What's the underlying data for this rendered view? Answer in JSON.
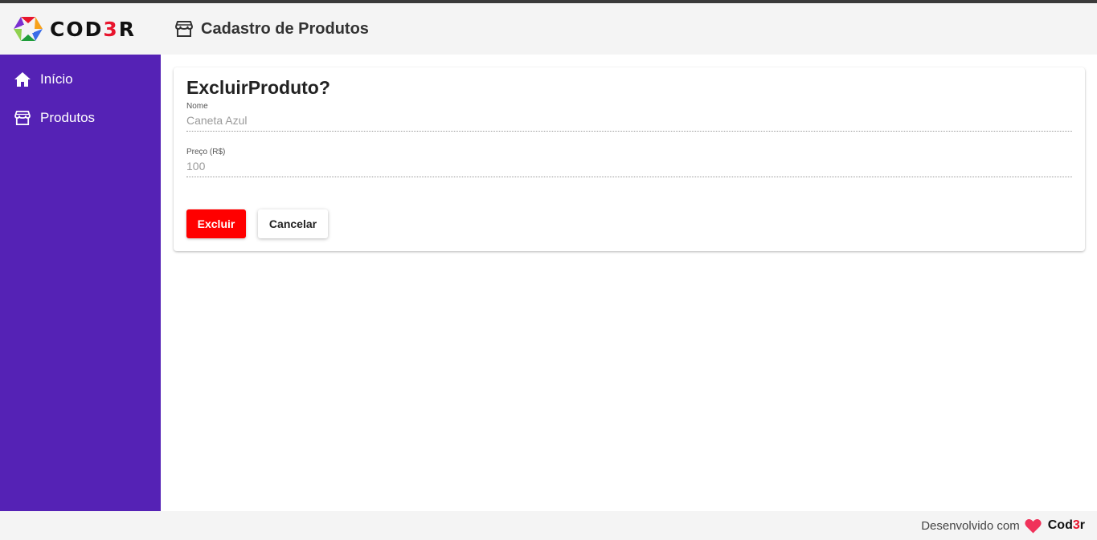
{
  "colors": {
    "sidebar": "#5522b5",
    "delete_button": "#ff0000",
    "heart": "#f0325a"
  },
  "logo": {
    "text_prefix": "COD",
    "text_accent": "3",
    "text_suffix": "R"
  },
  "header": {
    "icon": "store-icon",
    "title": "Cadastro de Produtos"
  },
  "sidebar": {
    "items": [
      {
        "icon": "home-icon",
        "label": "Início"
      },
      {
        "icon": "store-icon",
        "label": "Produtos"
      }
    ]
  },
  "card": {
    "title": "ExcluirProduto?",
    "fields": [
      {
        "label": "Nome",
        "value": "Caneta Azul"
      },
      {
        "label": "Preço (R$)",
        "value": "100"
      }
    ],
    "buttons": {
      "delete": "Excluir",
      "cancel": "Cancelar"
    }
  },
  "footer": {
    "text": "Desenvolvido com",
    "icon": "heart-icon",
    "brand_prefix": "Cod",
    "brand_accent": "3",
    "brand_suffix": "r"
  }
}
